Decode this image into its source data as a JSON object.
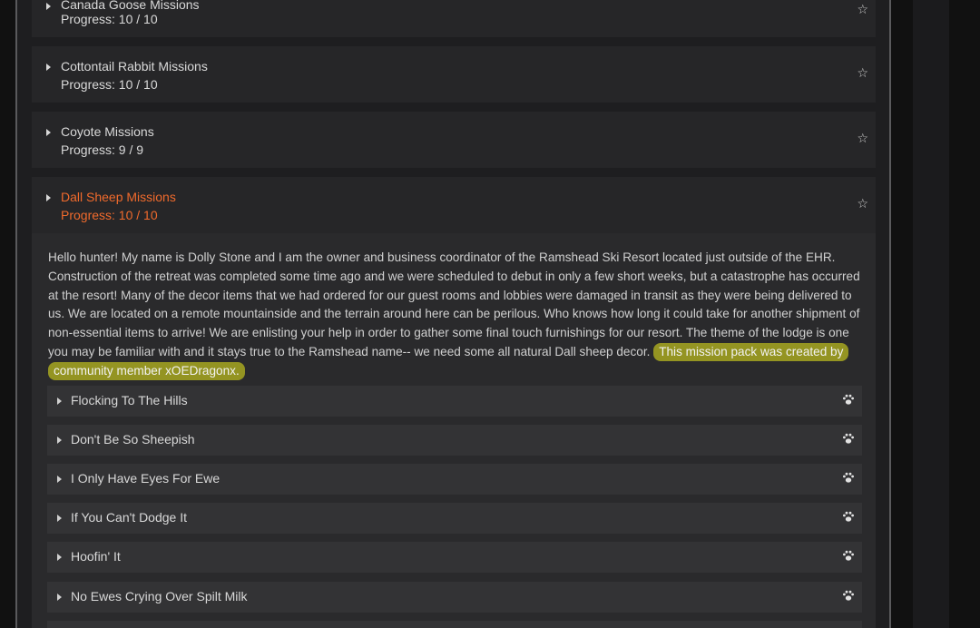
{
  "missions": [
    {
      "name": "Canada Goose Missions",
      "progress": "Progress: 10 / 10",
      "star_icon": "star-outline-icon"
    },
    {
      "name": "Cottontail Rabbit Missions",
      "progress": "Progress: 10 / 10",
      "star_icon": "star-outline-icon"
    },
    {
      "name": "Coyote Missions",
      "progress": "Progress: 9 / 9",
      "star_icon": "star-outline-icon"
    },
    {
      "name": "Dall Sheep Missions",
      "progress": "Progress: 10 / 10",
      "star_icon": "star-outline-icon",
      "expanded": true
    }
  ],
  "description": {
    "main": "Hello hunter! My name is Dolly Stone and I am the owner and business coordinator of the Ramshead Ski Resort located just outside of the EHR. Construction of the retreat was completed some time ago and we were scheduled to debut in only a few short weeks, but a catastrophe has occurred at the resort! Many of the decor items that we had ordered for our guest rooms and lobbies were damaged in transit as they were being delivered to us. We are located on a remote mountainside and the terrain around here can be perilous. Who knows how long it could take for another shipment of non-essential items to arrive! We are enlisting your help in order to gather some final touch furnishings for our resort. The theme of the lodge is one you may be familiar with and it stays true to the Ramshead name-- we need some all natural Dall sheep decor.",
    "highlighted": "This mission pack was created by community member xOEDragonx."
  },
  "sub_missions": [
    {
      "label": "Flocking To The Hills",
      "icon": "paw-icon"
    },
    {
      "label": "Don't Be So Sheepish",
      "icon": "paw-icon"
    },
    {
      "label": "I Only Have Eyes For Ewe",
      "icon": "paw-icon"
    },
    {
      "label": "If You Can't Dodge It",
      "icon": "paw-icon"
    },
    {
      "label": "Hoofin' It",
      "icon": "paw-icon"
    },
    {
      "label": "No Ewes Crying Over Spilt Milk",
      "icon": "paw-icon"
    },
    {
      "label": "",
      "icon": ""
    }
  ],
  "colors": {
    "accent": "#f06a2c",
    "highlight": "#bebe1e",
    "panel_bg": "#1e1e20",
    "header_bg": "#262628",
    "sub_item_bg": "#333335"
  }
}
